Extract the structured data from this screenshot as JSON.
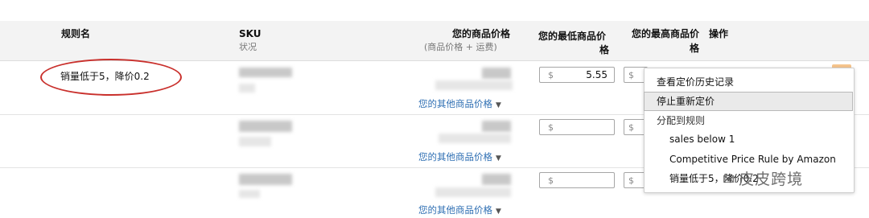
{
  "header": {
    "rule_name": "规则名",
    "sku": "SKU",
    "sku_sub": "状况",
    "your_price": "您的商品价格",
    "your_price_sub": "(商品价格 + 运费)",
    "min_price_l1": "您的最低商品价",
    "min_price_l2": "格",
    "max_price_l1": "您的最高商品价",
    "max_price_l2": "格",
    "actions": "操作"
  },
  "rows": [
    {
      "rule_name": "销量低于5，降价0.2",
      "other_prices_link": "您的其他商品价格",
      "min_price_currency": "$",
      "min_price_value": "5.55",
      "max_price_currency": "$"
    },
    {
      "other_prices_link": "您的其他商品价格",
      "min_price_currency": "$",
      "max_price_currency": "$"
    },
    {
      "other_prices_link": "您的其他商品价格",
      "min_price_currency": "$",
      "max_price_currency": "$"
    }
  ],
  "dropdown": {
    "items": [
      "查看定价历史记录",
      "停止重新定价",
      "分配到规则",
      "sales below 1",
      "Competitive Price Rule by Amazon",
      "销量低于5，降价0.2"
    ]
  },
  "watermark": {
    "icon": "wechat-icon",
    "text": "皮皮跨境"
  },
  "colors": {
    "annotation_ellipse": "#c9302c",
    "link": "#2f6fb3",
    "header_bg": "#f3f3f3"
  }
}
